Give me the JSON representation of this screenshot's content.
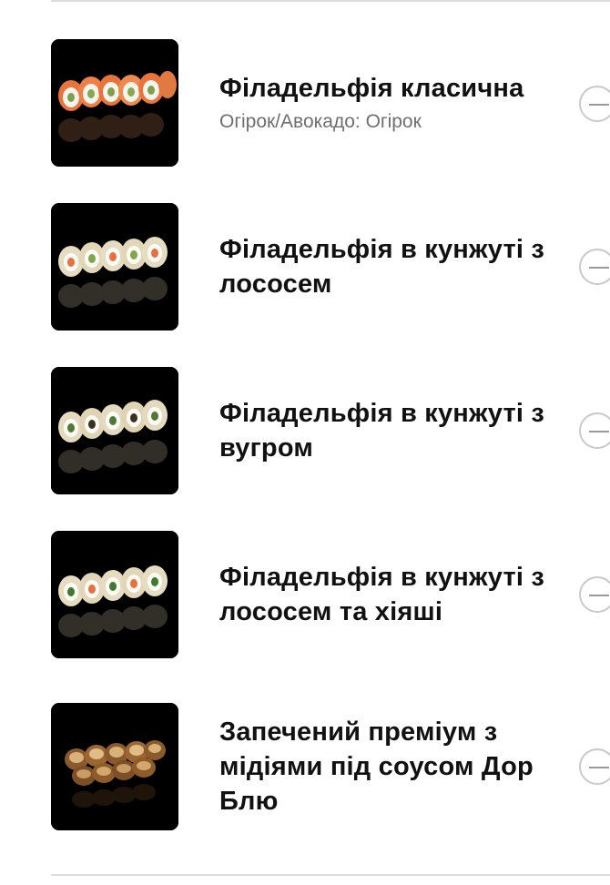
{
  "items": [
    {
      "name": "Філадельфія класична",
      "option": "Огірок/Авокадо: Огірок",
      "image_icon": "sushi-roll-salmon-photo"
    },
    {
      "name": "Філадельфія в кунжуті з лососем",
      "option": "",
      "image_icon": "sushi-roll-sesame-salmon-photo"
    },
    {
      "name": "Філадельфія в кунжуті з вугром",
      "option": "",
      "image_icon": "sushi-roll-sesame-eel-photo"
    },
    {
      "name": "Філадельфія в кунжуті з лососем та хіяші",
      "option": "",
      "image_icon": "sushi-roll-sesame-salmon-hiyashi-photo"
    },
    {
      "name": "Запечений преміум з мідіями під соусом Дор Блю",
      "option": "",
      "image_icon": "baked-sushi-roll-mussels-photo"
    }
  ],
  "colors": {
    "title": "#111111",
    "option": "#6f6f6f",
    "thumb_bg": "#000000",
    "button_border": "#c9c9c9"
  }
}
